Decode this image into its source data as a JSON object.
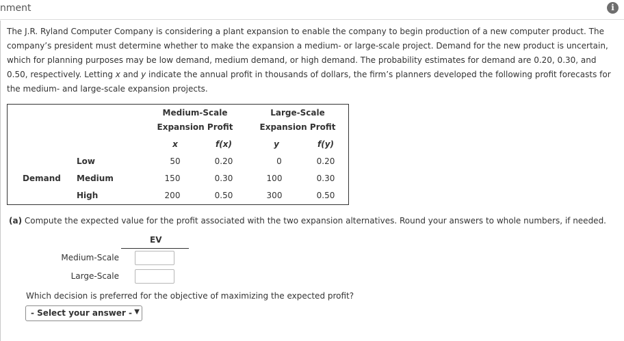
{
  "header": {
    "title": "nment",
    "info_icon": "i"
  },
  "problem": {
    "text_1": "The J.R. Ryland Computer Company is considering a plant expansion to enable the company to begin production of a new computer product. The company’s president must determine whether to make the expansion a medium- or large-scale project. Demand for the new product is uncertain, which for planning purposes may be low demand, medium demand, or high demand. The probability estimates for demand are 0.20, 0.30, and 0.50, respectively. Letting ",
    "var_x": "x",
    "text_2": " and ",
    "var_y": "y",
    "text_3": " indicate the annual profit in thousands of dollars, the firm’s planners developed the following profit forecasts for the medium- and large-scale expansion projects."
  },
  "table": {
    "medium_head_1": "Medium-Scale",
    "medium_head_2": "Expansion Profit",
    "large_head_1": "Large-Scale",
    "large_head_2": "Expansion Profit",
    "col_x": "x",
    "col_fx": "f(x)",
    "col_y": "y",
    "col_fy": "f(y)",
    "demand_label": "Demand",
    "rows": [
      {
        "level": "Low",
        "x": "50",
        "fx": "0.20",
        "y": "0",
        "fy": "0.20"
      },
      {
        "level": "Medium",
        "x": "150",
        "fx": "0.30",
        "y": "100",
        "fy": "0.30"
      },
      {
        "level": "High",
        "x": "200",
        "fx": "0.50",
        "y": "300",
        "fy": "0.50"
      }
    ]
  },
  "part_a": {
    "label": "(a)",
    "text": " Compute the expected value for the profit associated with the two expansion alternatives. Round your answers to whole numbers, if needed.",
    "ev_header": "EV",
    "rows": [
      {
        "label": "Medium-Scale",
        "value": ""
      },
      {
        "label": "Large-Scale",
        "value": ""
      }
    ],
    "question": "Which decision is preferred for the objective of maximizing the expected profit?",
    "select_value": "- Select your answer -"
  }
}
